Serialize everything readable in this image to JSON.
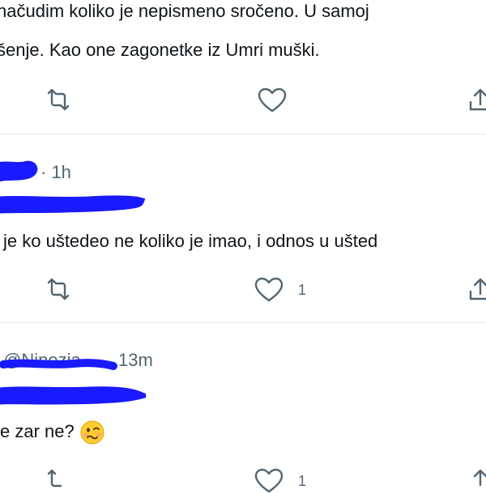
{
  "tweet1": {
    "lines": [
      "načudim koliko je nepismeno sročeno. U samoj",
      "šenje. Kao one zagonetke iz Umri muški."
    ]
  },
  "tweet2": {
    "timestamp": "· 1h",
    "lines": [
      "je ko uštedeo ne koliko je imao, i odnos u ušted"
    ],
    "like_count": "1"
  },
  "tweet3": {
    "handle_partial": "@Ninezia",
    "timestamp": "13m",
    "lines": [
      "e zar ne?"
    ],
    "emoji": "woozy-face",
    "like_count": "1"
  },
  "icons": {
    "retweet": "retweet-icon",
    "like": "heart-icon",
    "share": "share-icon"
  },
  "colors": {
    "text": "#0f1419",
    "muted": "#536471",
    "separator": "#e1e6ea",
    "redaction": "#1a1aff"
  }
}
